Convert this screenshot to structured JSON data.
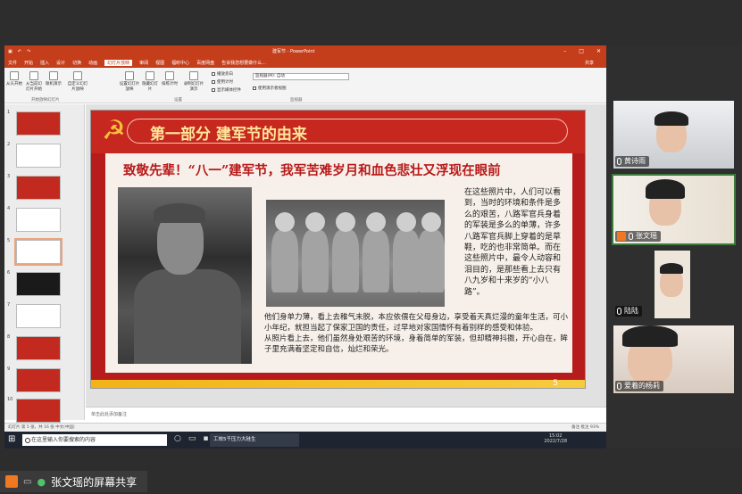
{
  "ppt": {
    "doc_title": "建军节 - PowerPoint",
    "tabs": [
      "文件",
      "开始",
      "插入",
      "设计",
      "切换",
      "动画",
      "幻灯片放映",
      "审阅",
      "视图",
      "福昕中心",
      "百度网盘"
    ],
    "active_tab": "幻灯片放映",
    "tell_me": "告诉我您想要做什么...",
    "share": "共享",
    "ribbon_buttons": [
      "从头开始",
      "从当前幻灯片开始",
      "联机演示",
      "自定义幻灯片放映",
      "设置幻灯片放映",
      "隐藏幻灯片",
      "排练计时",
      "录制幻灯片演示"
    ],
    "ribbon_checks": [
      "播放旁白",
      "使用计时",
      "显示媒体控件"
    ],
    "monitor_label": "监视器(M): 自动",
    "presenter_view": "使用演示者视图",
    "groups": [
      "开始放映幻灯片",
      "设置",
      "监视器"
    ],
    "thumbs": [
      "1",
      "2",
      "3",
      "4",
      "5",
      "6",
      "7",
      "8",
      "9",
      "10"
    ],
    "notes_placeholder": "单击此处添加备注",
    "status_left": "幻灯片 第 5 张，共 16 张   中文(中国)",
    "status_right": "备注   批注        93%"
  },
  "slide": {
    "title": "第一部分  建军节的由来",
    "headline": "致敬先辈！“八一”建军节，我军苦难岁月和血色悲壮又浮现在眼前",
    "right_text": "在这些照片中，人们可以看到，当时的环境和条件是多么的艰苦，八路军官兵身着的军装是多么的单薄，许多八路军官兵脚上穿着的是草鞋，吃的也非常简单。而在这些照片中，最令人动容和泪目的，是那些看上去只有八九岁和十来岁的“小八路”。",
    "bottom_p1": "他们身单力薄，看上去稚气未脱，本应依偎在父母身边，享受着天真烂漫的童年生活，可小小年纪，就担当起了保家卫国的责任，过早地对家国情怀有着别样的感受和体验。",
    "bottom_p2": "从照片看上去，他们虽然身处艰苦的环境，身着简单的军装，但却精神抖擞，开心自在，眸子里充满着坚定和自信，灿烂和荣光。",
    "page_number": "5"
  },
  "taskbar": {
    "search_placeholder": "在这里输入你要搜索的内容",
    "running_app": "工效5千压力大硅生",
    "time": "15:02",
    "date": "2022/7/28"
  },
  "participants": [
    {
      "name": "黄诗雨"
    },
    {
      "name": "张文瑶"
    },
    {
      "name": "陆陆"
    },
    {
      "name": "爱着的杨莉"
    }
  ],
  "screen_share": {
    "label": "张文瑶的屏幕共享"
  }
}
